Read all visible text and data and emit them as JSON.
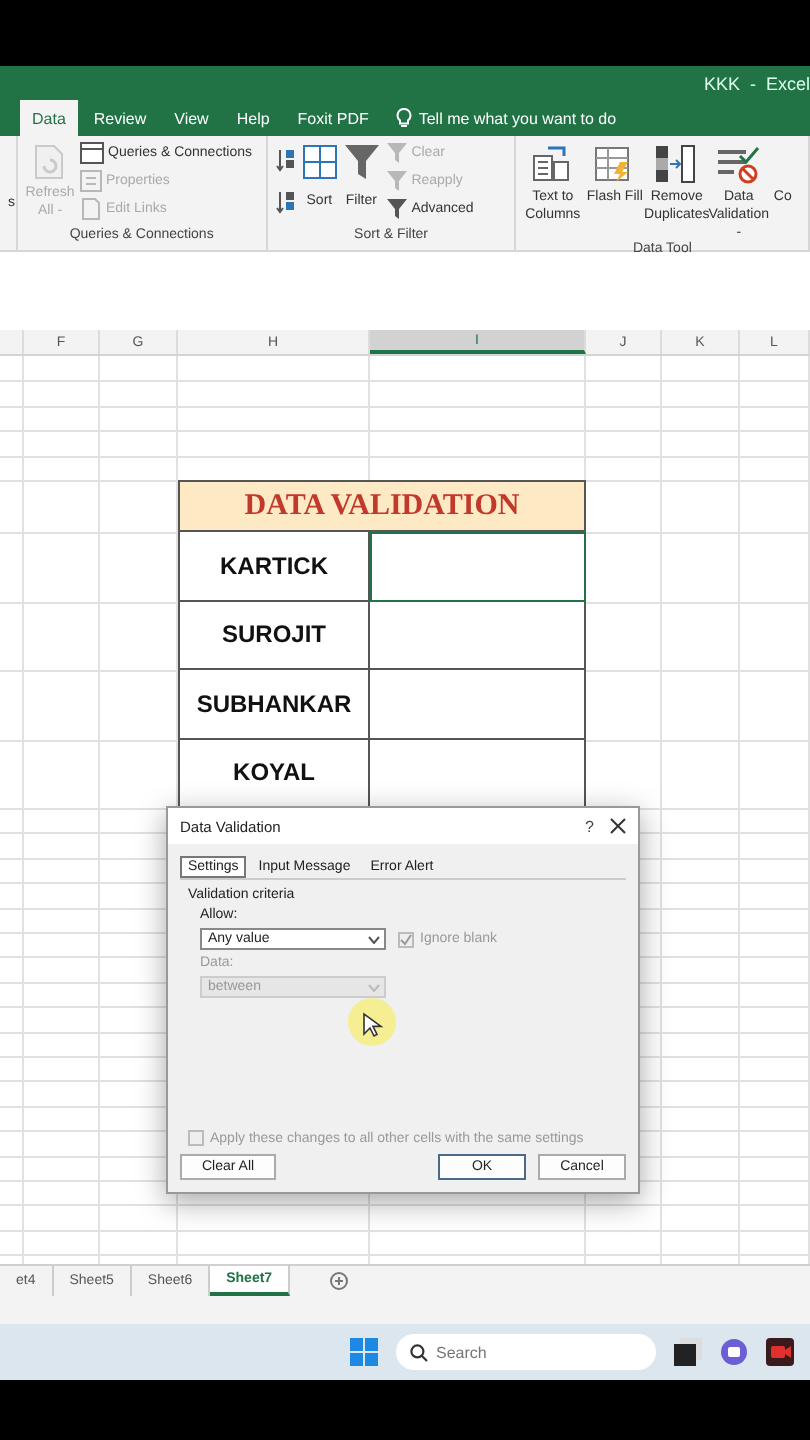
{
  "title_bar": {
    "title": "KKK  -  Excel"
  },
  "ribbon_tabs": [
    {
      "label": "Data",
      "selected": true
    },
    {
      "label": "Review",
      "selected": false
    },
    {
      "label": "View",
      "selected": false
    },
    {
      "label": "Help",
      "selected": false
    },
    {
      "label": "Foxit PDF",
      "selected": false
    }
  ],
  "tell_me": "Tell me what you want to do",
  "ribbon_groups": [
    {
      "items": [
        {
          "kind": "partial",
          "label": "s",
          "disabled": false
        }
      ]
    },
    {
      "label": "Queries & Connections",
      "items": [
        {
          "kind": "refresh",
          "label": "Refresh All -",
          "disabled": true
        },
        {
          "kind": "queries",
          "label": "Queries & Connections",
          "disabled": false
        },
        {
          "kind": "properties",
          "label": "Properties",
          "disabled": true
        },
        {
          "kind": "links",
          "label": "Edit Links",
          "disabled": true
        }
      ]
    },
    {
      "label": "Sort & Filter",
      "items": [
        {
          "kind": "sortpair",
          "disabled": false
        },
        {
          "kind": "sort",
          "label": "Sort",
          "disabled": false
        },
        {
          "kind": "filter",
          "label": "Filter",
          "disabled": false
        },
        {
          "kind": "clear",
          "label": "Clear",
          "disabled": true
        },
        {
          "kind": "reapply",
          "label": "Reapply",
          "disabled": true
        },
        {
          "kind": "advanced",
          "label": "Advanced",
          "disabled": false
        }
      ]
    },
    {
      "label": "Data Tool",
      "items": [
        {
          "kind": "textcols",
          "label": "Text to Columns",
          "disabled": false
        },
        {
          "kind": "flashfill",
          "label": "Flash Fill",
          "disabled": false
        },
        {
          "kind": "dupes",
          "label": "Remove Duplicates",
          "disabled": false
        },
        {
          "kind": "validation",
          "label": "Data Validation -",
          "disabled": false
        },
        {
          "kind": "partial",
          "label": "Co",
          "disabled": false
        }
      ]
    }
  ],
  "columns": [
    {
      "selected": false
    },
    {
      "letter": "F",
      "selected": false
    },
    {
      "letter": "G",
      "selected": false
    },
    {
      "letter": "H",
      "selected": false
    },
    {
      "letter": "I",
      "selected": true
    },
    {
      "letter": "J",
      "selected": false
    },
    {
      "letter": "K",
      "selected": false
    },
    {
      "letter": "L",
      "selected": false
    }
  ],
  "table": {
    "title": "DATA VALIDATION",
    "rows": [
      {
        "name": "KARTICK",
        "selected": true
      },
      {
        "name": "SUROJIT",
        "selected": false
      },
      {
        "name": "SUBHANKAR",
        "selected": false
      },
      {
        "name": "KOYAL",
        "selected": false
      }
    ]
  },
  "dialog": {
    "title": "Data Validation",
    "help": "?",
    "tabs": [
      {
        "label": "Settings",
        "selected": true
      },
      {
        "label": "Input Message",
        "selected": false
      },
      {
        "label": "Error Alert",
        "selected": false
      }
    ],
    "section": "Validation criteria",
    "allow_label": "Allow:",
    "allow_value": "Any value",
    "ignore_blank": {
      "label": "Ignore blank",
      "checked": true,
      "disabled": true
    },
    "data_label": "Data:",
    "data_value": "between",
    "data_disabled": true,
    "apply_all": {
      "label": "Apply these changes to all other cells with the same settings",
      "checked": false,
      "disabled": true
    },
    "buttons": [
      {
        "label": "Clear All",
        "kind": "left"
      },
      {
        "label": "OK",
        "kind": "default"
      },
      {
        "label": "Cancel",
        "kind": "normal"
      }
    ]
  },
  "sheet_tabs": [
    {
      "label": "et4",
      "selected": false
    },
    {
      "label": "Sheet5",
      "selected": false
    },
    {
      "label": "Sheet6",
      "selected": false
    },
    {
      "label": "Sheet7",
      "selected": true
    }
  ],
  "taskbar": {
    "search": {
      "placeholder": "Search"
    }
  }
}
